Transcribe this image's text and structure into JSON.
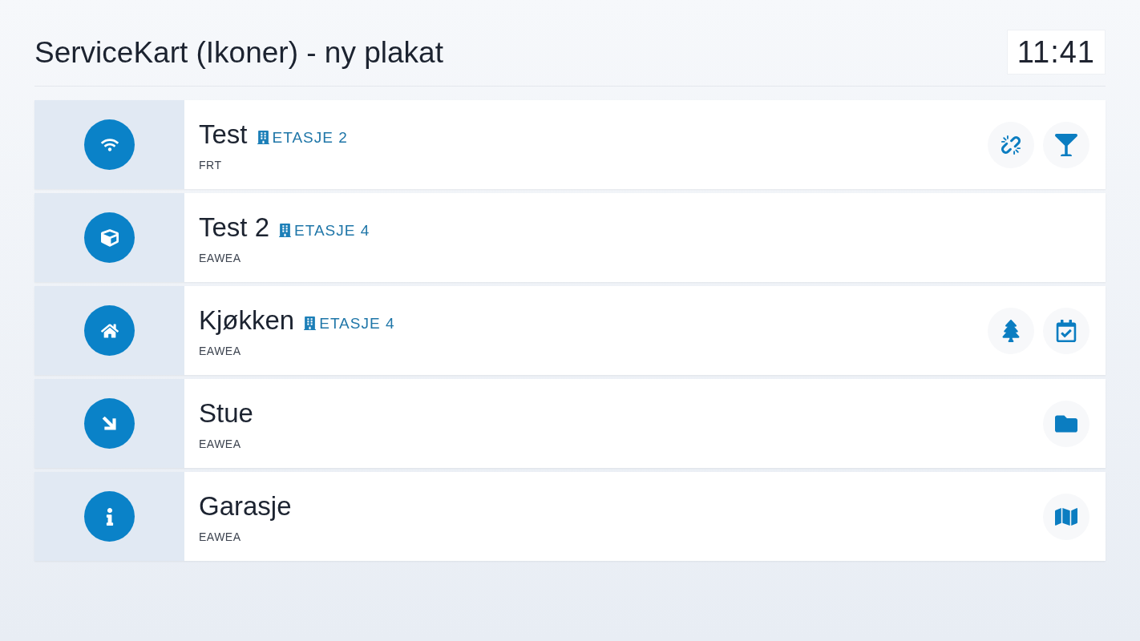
{
  "header": {
    "title": "ServiceKart (Ikoner) - ny plakat",
    "clock": "11:41"
  },
  "rows": [
    {
      "kind": "wifi",
      "title": "Test",
      "floor": "ETASJE 2",
      "subtitle": "FRT",
      "actions": [
        {
          "kind": "unlink"
        },
        {
          "kind": "cocktail"
        }
      ]
    },
    {
      "kind": "cube",
      "title": "Test 2",
      "floor": "ETASJE 4",
      "subtitle": "EAWEA"
    },
    {
      "kind": "home",
      "title": "Kjøkken",
      "floor": "ETASJE 4",
      "subtitle": "EAWEA",
      "actions": [
        {
          "kind": "tree"
        },
        {
          "kind": "calendar"
        }
      ]
    },
    {
      "kind": "arrow",
      "title": "Stue",
      "subtitle": "EAWEA",
      "actions": [
        {
          "kind": "folder"
        }
      ]
    },
    {
      "kind": "info",
      "title": "Garasje",
      "subtitle": "EAWEA",
      "actions": [
        {
          "kind": "map"
        }
      ]
    }
  ]
}
